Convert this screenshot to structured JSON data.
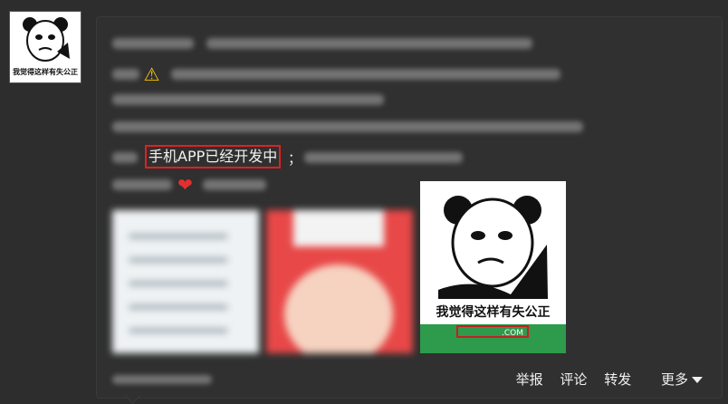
{
  "avatar": {
    "caption": "我觉得这样有失公正",
    "icon": "panda-meme-icon"
  },
  "post": {
    "highlight_text": "手机APP已经开发中",
    "semicolon": "；",
    "warning_icon": "⚠",
    "heart_icon": "❤",
    "image_caption": "我觉得这样有失公正",
    "image_url_suffix": ".COM"
  },
  "actions": {
    "report": "举报",
    "comment": "评论",
    "share": "转发",
    "more": "更多"
  },
  "colors": {
    "highlight_border": "#e02020",
    "meme_footer": "#2e9a4c"
  }
}
